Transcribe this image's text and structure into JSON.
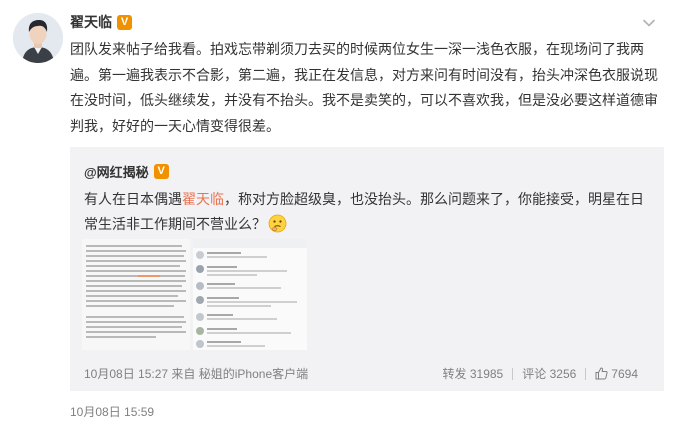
{
  "post": {
    "author": "翟天临",
    "verified_badge": "V",
    "text": "团队发来帖子给我看。拍戏忘带剃须刀去买的时候两位女生一深一浅色衣服，在现场问了我两遍。第一遍我表示不合影，第二遍，我正在发信息，对方来问有时间没有，抬头冲深色衣服说现在没时间，低头继续发，并没有不抬头。我不是卖笑的，可以不喜欢我，但是没必要这样道德审判我，好好的一天心情变得很差。",
    "time": "10月08日 15:59"
  },
  "quote": {
    "author": "@网红揭秘",
    "verified_badge": "V",
    "text_before": "有人在日本偶遇",
    "mention": "翟天临",
    "text_after": "，称对方脸超级臭，也没抬头。那么问题来了，你能接受，明星在日常生活非工作期间不营业么？",
    "emoji": "thinking-face-icon",
    "time": "10月08日 15:27",
    "via_label": "来自",
    "source": "秘姐的iPhone客户端",
    "repost_label": "转发",
    "repost_count": "31985",
    "comment_label": "评论",
    "comment_count": "3256",
    "like_count": "7694"
  },
  "colors": {
    "mention": "#eb7350",
    "badge": "#f29100",
    "quote_bg": "#f2f2f5",
    "meta_text": "#808080"
  }
}
